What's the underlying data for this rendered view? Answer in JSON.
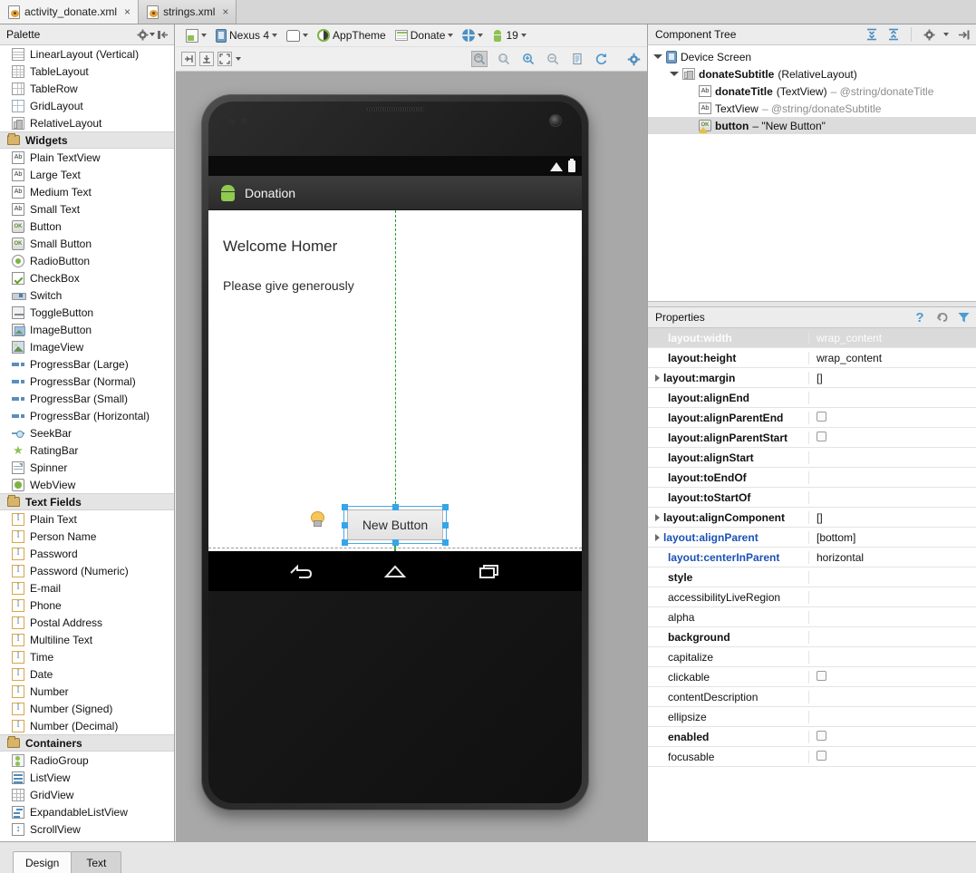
{
  "editor_tabs": [
    {
      "label": "activity_donate.xml",
      "icon": "xml-file-icon",
      "active": true,
      "close": "×"
    },
    {
      "label": "strings.xml",
      "icon": "xml-file-icon",
      "active": false,
      "close": "×"
    }
  ],
  "palette": {
    "title": "Palette",
    "header_icons": [
      "gear-icon",
      "collapse-icon"
    ],
    "items": [
      {
        "label": "LinearLayout (Vertical)",
        "icon": "linearlayout-icon",
        "type": "item"
      },
      {
        "label": "TableLayout",
        "icon": "tablelayout-icon",
        "type": "item"
      },
      {
        "label": "TableRow",
        "icon": "tablerow-icon",
        "type": "item"
      },
      {
        "label": "GridLayout",
        "icon": "gridlayout-icon",
        "type": "item"
      },
      {
        "label": "RelativeLayout",
        "icon": "relativelayout-icon",
        "type": "item"
      },
      {
        "label": "Widgets",
        "icon": "folder-icon",
        "type": "group"
      },
      {
        "label": "Plain TextView",
        "icon": "textview-icon",
        "type": "item"
      },
      {
        "label": "Large Text",
        "icon": "textview-icon",
        "type": "item"
      },
      {
        "label": "Medium Text",
        "icon": "textview-icon",
        "type": "item"
      },
      {
        "label": "Small Text",
        "icon": "textview-icon",
        "type": "item"
      },
      {
        "label": "Button",
        "icon": "button-icon",
        "type": "item"
      },
      {
        "label": "Small Button",
        "icon": "button-icon",
        "type": "item"
      },
      {
        "label": "RadioButton",
        "icon": "radiobutton-icon",
        "type": "item"
      },
      {
        "label": "CheckBox",
        "icon": "checkbox-icon",
        "type": "item"
      },
      {
        "label": "Switch",
        "icon": "switch-icon",
        "type": "item"
      },
      {
        "label": "ToggleButton",
        "icon": "togglebutton-icon",
        "type": "item"
      },
      {
        "label": "ImageButton",
        "icon": "imagebutton-icon",
        "type": "item"
      },
      {
        "label": "ImageView",
        "icon": "imageview-icon",
        "type": "item"
      },
      {
        "label": "ProgressBar (Large)",
        "icon": "progressbar-icon",
        "type": "item"
      },
      {
        "label": "ProgressBar (Normal)",
        "icon": "progressbar-icon",
        "type": "item"
      },
      {
        "label": "ProgressBar (Small)",
        "icon": "progressbar-icon",
        "type": "item"
      },
      {
        "label": "ProgressBar (Horizontal)",
        "icon": "progressbar-icon",
        "type": "item"
      },
      {
        "label": "SeekBar",
        "icon": "seekbar-icon",
        "type": "item"
      },
      {
        "label": "RatingBar",
        "icon": "ratingbar-icon",
        "type": "item"
      },
      {
        "label": "Spinner",
        "icon": "spinner-icon",
        "type": "item"
      },
      {
        "label": "WebView",
        "icon": "webview-icon",
        "type": "item"
      },
      {
        "label": "Text Fields",
        "icon": "folder-icon",
        "type": "group"
      },
      {
        "label": "Plain Text",
        "icon": "textfield-icon",
        "type": "item"
      },
      {
        "label": "Person Name",
        "icon": "textfield-icon",
        "type": "item"
      },
      {
        "label": "Password",
        "icon": "textfield-icon",
        "type": "item"
      },
      {
        "label": "Password (Numeric)",
        "icon": "textfield-icon",
        "type": "item"
      },
      {
        "label": "E-mail",
        "icon": "textfield-icon",
        "type": "item"
      },
      {
        "label": "Phone",
        "icon": "textfield-icon",
        "type": "item"
      },
      {
        "label": "Postal Address",
        "icon": "textfield-icon",
        "type": "item"
      },
      {
        "label": "Multiline Text",
        "icon": "textfield-icon",
        "type": "item"
      },
      {
        "label": "Time",
        "icon": "textfield-icon",
        "type": "item"
      },
      {
        "label": "Date",
        "icon": "textfield-icon",
        "type": "item"
      },
      {
        "label": "Number",
        "icon": "textfield-icon",
        "type": "item"
      },
      {
        "label": "Number (Signed)",
        "icon": "textfield-icon",
        "type": "item"
      },
      {
        "label": "Number (Decimal)",
        "icon": "textfield-icon",
        "type": "item"
      },
      {
        "label": "Containers",
        "icon": "folder-icon",
        "type": "group"
      },
      {
        "label": "RadioGroup",
        "icon": "radiogroup-icon",
        "type": "item"
      },
      {
        "label": "ListView",
        "icon": "listview-icon",
        "type": "item"
      },
      {
        "label": "GridView",
        "icon": "gridview-icon",
        "type": "item"
      },
      {
        "label": "ExpandableListView",
        "icon": "expandablelistview-icon",
        "type": "item"
      },
      {
        "label": "ScrollView",
        "icon": "scrollview-icon",
        "type": "item"
      }
    ]
  },
  "canvas_toolbar": {
    "device_config": "",
    "device": "Nexus 4",
    "orientation": "",
    "theme": "AppTheme",
    "activity": "Donate",
    "locale": "",
    "api_level": "19",
    "align_buttons": [
      "snap-to-grid-icon",
      "snap-vertical-icon",
      "fit-icon"
    ],
    "zoom_buttons": [
      "zoom-fit-icon",
      "zoom-actual-icon",
      "zoom-in-icon",
      "zoom-out-icon",
      "render-icon",
      "refresh-icon",
      "settings-icon"
    ]
  },
  "preview": {
    "app_title": "Donation",
    "welcome_text": "Welcome Homer",
    "subtitle_text": "Please give generously",
    "button_text": "New Button",
    "status_icons": [
      "wifi-icon",
      "battery-icon"
    ],
    "nav_icons": [
      "back-icon",
      "home-icon",
      "recents-icon"
    ],
    "guide_color": "#19a519",
    "selection_color": "#35a5e8"
  },
  "component_tree": {
    "title": "Component Tree",
    "header_icons": [
      "expand-all-icon",
      "collapse-all-icon",
      "gear-icon",
      "hide-icon"
    ],
    "nodes": [
      {
        "depth": 0,
        "expander": "open",
        "icon": "device-screen-icon",
        "name": "Device Screen",
        "type": "",
        "ref": "",
        "selected": false,
        "bold": false
      },
      {
        "depth": 1,
        "expander": "open",
        "icon": "relativelayout-icon",
        "name": "donateSubtitle",
        "type": "(RelativeLayout)",
        "ref": "",
        "selected": false,
        "bold": true
      },
      {
        "depth": 2,
        "expander": "none",
        "icon": "textview-icon",
        "name": "donateTitle",
        "type": "(TextView)",
        "ref": "– @string/donateTitle",
        "selected": false,
        "bold": true
      },
      {
        "depth": 2,
        "expander": "none",
        "icon": "textview-icon",
        "name": "TextView",
        "type": "",
        "ref": "– @string/donateSubtitle",
        "selected": false,
        "bold": false
      },
      {
        "depth": 2,
        "expander": "none",
        "icon": "button-warning-icon",
        "name": "button",
        "type": "",
        "ref": "– \"New Button\"",
        "selected": true,
        "bold": true
      }
    ]
  },
  "properties": {
    "title": "Properties",
    "header_icons": [
      "help-icon",
      "restore-icon",
      "filter-icon"
    ],
    "rows": [
      {
        "name": "layout:width",
        "value": "wrap_content",
        "selected": true,
        "bold": true,
        "blue": false,
        "expander": false,
        "checkbox": false
      },
      {
        "name": "layout:height",
        "value": "wrap_content",
        "selected": false,
        "bold": true,
        "blue": false,
        "expander": false,
        "checkbox": false
      },
      {
        "name": "layout:margin",
        "value": "[]",
        "selected": false,
        "bold": true,
        "blue": false,
        "expander": true,
        "checkbox": false
      },
      {
        "name": "layout:alignEnd",
        "value": "",
        "selected": false,
        "bold": true,
        "blue": false,
        "expander": false,
        "checkbox": false
      },
      {
        "name": "layout:alignParentEnd",
        "value": "",
        "selected": false,
        "bold": true,
        "blue": false,
        "expander": false,
        "checkbox": true
      },
      {
        "name": "layout:alignParentStart",
        "value": "",
        "selected": false,
        "bold": true,
        "blue": false,
        "expander": false,
        "checkbox": true
      },
      {
        "name": "layout:alignStart",
        "value": "",
        "selected": false,
        "bold": true,
        "blue": false,
        "expander": false,
        "checkbox": false
      },
      {
        "name": "layout:toEndOf",
        "value": "",
        "selected": false,
        "bold": true,
        "blue": false,
        "expander": false,
        "checkbox": false
      },
      {
        "name": "layout:toStartOf",
        "value": "",
        "selected": false,
        "bold": true,
        "blue": false,
        "expander": false,
        "checkbox": false
      },
      {
        "name": "layout:alignComponent",
        "value": "[]",
        "selected": false,
        "bold": true,
        "blue": false,
        "expander": true,
        "checkbox": false
      },
      {
        "name": "layout:alignParent",
        "value": "[bottom]",
        "selected": false,
        "bold": true,
        "blue": true,
        "expander": true,
        "checkbox": false
      },
      {
        "name": "layout:centerInParent",
        "value": "horizontal",
        "selected": false,
        "bold": true,
        "blue": true,
        "expander": false,
        "checkbox": false
      },
      {
        "name": "style",
        "value": "",
        "selected": false,
        "bold": true,
        "blue": false,
        "expander": false,
        "checkbox": false
      },
      {
        "name": "accessibilityLiveRegion",
        "value": "",
        "selected": false,
        "bold": false,
        "blue": false,
        "expander": false,
        "checkbox": false
      },
      {
        "name": "alpha",
        "value": "",
        "selected": false,
        "bold": false,
        "blue": false,
        "expander": false,
        "checkbox": false
      },
      {
        "name": "background",
        "value": "",
        "selected": false,
        "bold": true,
        "blue": false,
        "expander": false,
        "checkbox": false
      },
      {
        "name": "capitalize",
        "value": "",
        "selected": false,
        "bold": false,
        "blue": false,
        "expander": false,
        "checkbox": false
      },
      {
        "name": "clickable",
        "value": "",
        "selected": false,
        "bold": false,
        "blue": false,
        "expander": false,
        "checkbox": true
      },
      {
        "name": "contentDescription",
        "value": "",
        "selected": false,
        "bold": false,
        "blue": false,
        "expander": false,
        "checkbox": false
      },
      {
        "name": "ellipsize",
        "value": "",
        "selected": false,
        "bold": false,
        "blue": false,
        "expander": false,
        "checkbox": false
      },
      {
        "name": "enabled",
        "value": "",
        "selected": false,
        "bold": true,
        "blue": false,
        "expander": false,
        "checkbox": true
      },
      {
        "name": "focusable",
        "value": "",
        "selected": false,
        "bold": false,
        "blue": false,
        "expander": false,
        "checkbox": true
      }
    ]
  },
  "bottom_tabs": [
    {
      "label": "Design",
      "active": true
    },
    {
      "label": "Text",
      "active": false
    }
  ]
}
